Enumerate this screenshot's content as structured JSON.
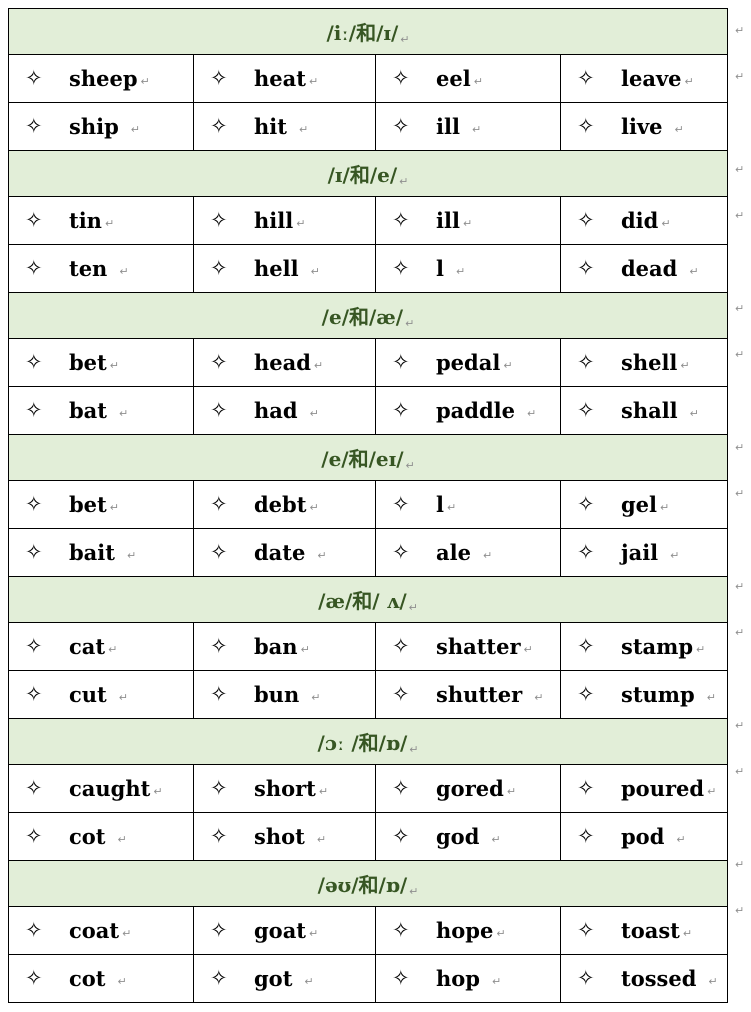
{
  "document": {
    "bullet_glyph": "✧",
    "bullet_icon_name": "four-pointed-star-bullet",
    "return_mark": "↵",
    "header_bg_color": "#e2eed8",
    "header_text_color": "#375623",
    "border_color": "#000000",
    "body_text_color": "#000000"
  },
  "sections": [
    {
      "title": "/iː/和/ɪ/",
      "columns": [
        {
          "top": "sheep",
          "bottom": "ship"
        },
        {
          "top": "heat",
          "bottom": "hit"
        },
        {
          "top": "eel",
          "bottom": "ill"
        },
        {
          "top": "leave",
          "bottom": "live"
        }
      ]
    },
    {
      "title": "/ɪ/和/e/",
      "columns": [
        {
          "top": "tin",
          "bottom": "ten"
        },
        {
          "top": "hill",
          "bottom": "hell"
        },
        {
          "top": "ill",
          "bottom": "l"
        },
        {
          "top": "did",
          "bottom": "dead"
        }
      ]
    },
    {
      "title": "/e/和/æ/",
      "columns": [
        {
          "top": "bet",
          "bottom": "bat"
        },
        {
          "top": "head",
          "bottom": "had"
        },
        {
          "top": "pedal",
          "bottom": "paddle"
        },
        {
          "top": "shell",
          "bottom": "shall"
        }
      ]
    },
    {
      "title": "/e/和/eɪ/",
      "columns": [
        {
          "top": "bet",
          "bottom": "bait"
        },
        {
          "top": "debt",
          "bottom": "date"
        },
        {
          "top": "l",
          "bottom": "ale"
        },
        {
          "top": "gel",
          "bottom": "jail"
        }
      ]
    },
    {
      "title": "/æ/和/ ʌ/",
      "columns": [
        {
          "top": "cat",
          "bottom": "cut"
        },
        {
          "top": "ban",
          "bottom": "bun"
        },
        {
          "top": "shatter",
          "bottom": "shutter"
        },
        {
          "top": "stamp",
          "bottom": "stump"
        }
      ]
    },
    {
      "title": "/ɔː /和/ɒ/",
      "columns": [
        {
          "top": "caught",
          "bottom": "cot"
        },
        {
          "top": "short",
          "bottom": "shot"
        },
        {
          "top": "gored",
          "bottom": "god"
        },
        {
          "top": "poured",
          "bottom": "pod"
        }
      ]
    },
    {
      "title": "/əʊ/和/ɒ/",
      "columns": [
        {
          "top": "coat",
          "bottom": "cot"
        },
        {
          "top": "goat",
          "bottom": "got"
        },
        {
          "top": "hope",
          "bottom": "hop"
        },
        {
          "top": "toast",
          "bottom": "tossed"
        }
      ]
    }
  ],
  "outside_marks": [
    "↵",
    "↵",
    "↵",
    "↵",
    "↵",
    "↵",
    "↵",
    "↵",
    "↵",
    "↵",
    "↵",
    "↵",
    "↵",
    "↵"
  ]
}
